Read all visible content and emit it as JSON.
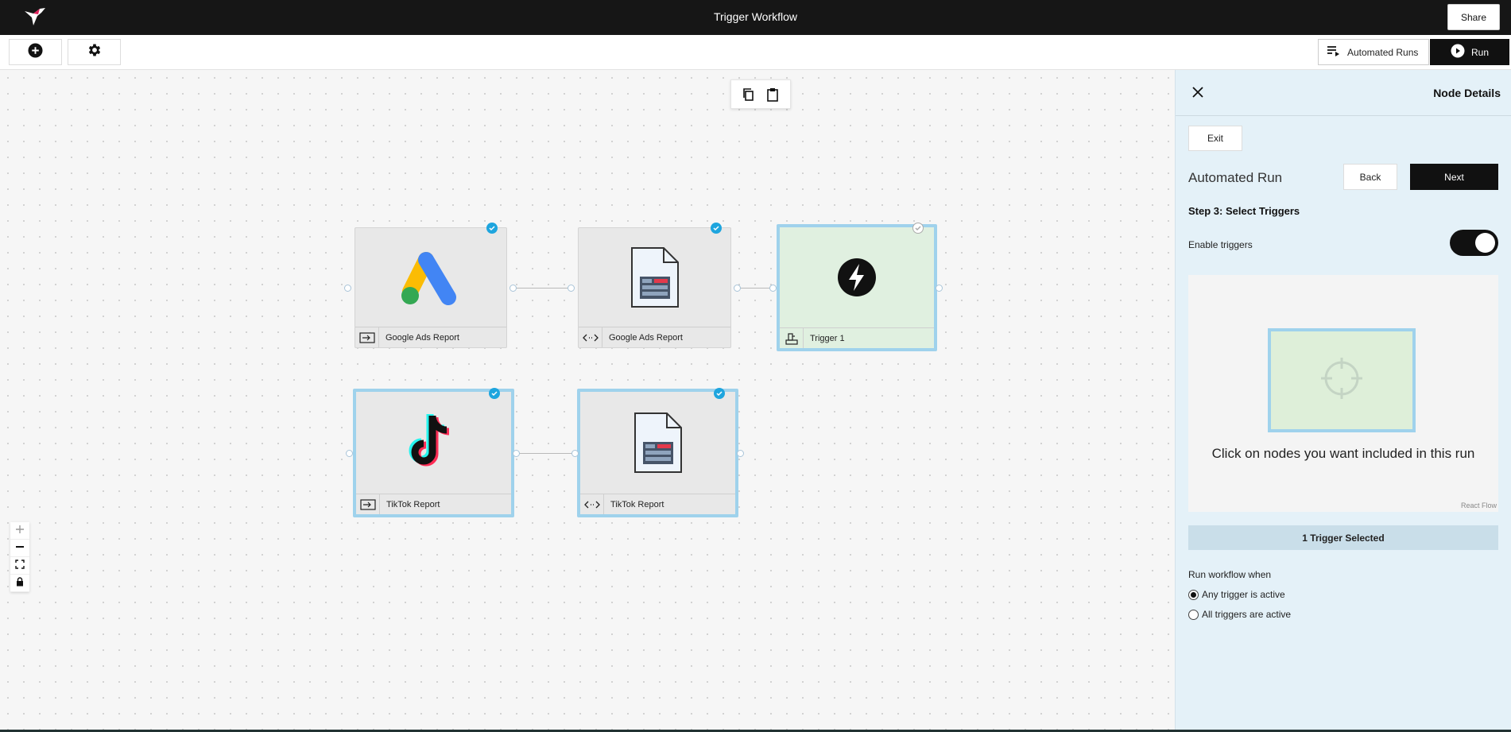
{
  "header": {
    "title": "Trigger Workflow",
    "share_label": "Share"
  },
  "toolbar": {
    "automated_runs_label": "Automated Runs",
    "run_label": "Run"
  },
  "canvas": {
    "nodes": [
      {
        "label": "Google Ads Report",
        "icon": "google-ads-icon",
        "type_icon": "input-icon",
        "selected": true
      },
      {
        "label": "Google Ads Report",
        "icon": "spreadsheet-file-icon",
        "type_icon": "code-icon",
        "selected": true
      },
      {
        "label": "Trigger 1",
        "icon": "lightning-icon",
        "type_icon": "trigger-icon",
        "selected": true
      },
      {
        "label": "TikTok Report",
        "icon": "tiktok-icon",
        "type_icon": "input-icon",
        "selected": true
      },
      {
        "label": "TikTok Report",
        "icon": "spreadsheet-file-icon",
        "type_icon": "code-icon",
        "selected": true
      }
    ]
  },
  "panel": {
    "title": "Node Details",
    "exit_label": "Exit",
    "heading": "Automated Run",
    "back_label": "Back",
    "next_label": "Next",
    "step_label": "Step 3: Select Triggers",
    "enable_triggers_label": "Enable triggers",
    "enable_triggers_on": true,
    "preview_text": "Click on nodes you want included in this run",
    "react_flow_credit": "React Flow",
    "trigger_count_label": "1 Trigger Selected",
    "run_when_label": "Run workflow when",
    "options": [
      {
        "label": "Any trigger is active",
        "checked": true
      },
      {
        "label": "All triggers are active",
        "checked": false
      }
    ]
  },
  "colors": {
    "accent": "#1ea5de",
    "selection": "#9fd2ec",
    "dark": "#161616",
    "panel_bg": "#e4f1f8",
    "trigger_bg": "#e0f0e0"
  }
}
